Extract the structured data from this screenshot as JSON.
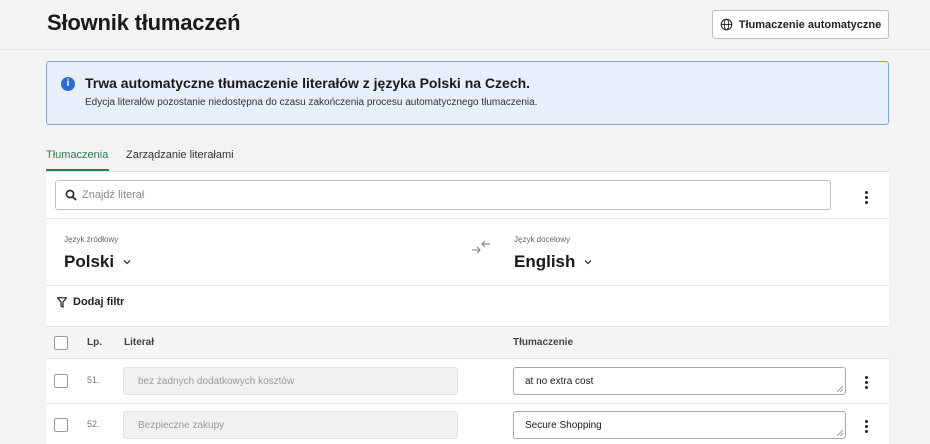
{
  "header": {
    "title": "Słownik tłumaczeń",
    "auto_translate_label": "Tłumaczenie automatyczne"
  },
  "info_banner": {
    "title": "Trwa automatyczne tłumaczenie literałów z języka Polski na Czech.",
    "subtitle": "Edycja literałów pozostanie niedostępna do czasu zakończenia procesu automatycznego tłumaczenia."
  },
  "tabs": [
    {
      "label": "Tłumaczenia",
      "active": true
    },
    {
      "label": "Zarządzanie literałami",
      "active": false
    }
  ],
  "search": {
    "placeholder": "Znajdź literał",
    "value": ""
  },
  "languages": {
    "source_label": "Język źródłowy",
    "source_value": "Polski",
    "target_label": "Język docelowy",
    "target_value": "English"
  },
  "filter": {
    "label": "Dodaj filtr"
  },
  "table": {
    "columns": {
      "number": "Lp.",
      "literal": "Literał",
      "translation": "Tłumaczenie"
    },
    "rows": [
      {
        "number": "51.",
        "literal": "bez żadnych dodatkowych kosztów",
        "translation": "at no extra cost"
      },
      {
        "number": "52.",
        "literal": "Bezpieczne zakupy",
        "translation": "Secure Shopping"
      }
    ]
  },
  "colors": {
    "accent": "#2e7d4f",
    "info_bg": "#e8eefa",
    "info_border": "#7fa4dd",
    "info_icon": "#2f6bd0"
  }
}
